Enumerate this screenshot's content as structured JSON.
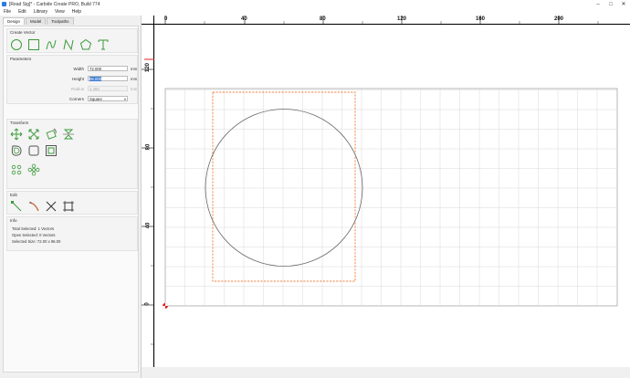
{
  "window": {
    "title": "[Read Sig]* - Carbide Create PRO, Build 774",
    "controls": [
      "–",
      "□",
      "✕"
    ]
  },
  "menubar": [
    "File",
    "Edit",
    "Library",
    "View",
    "Help"
  ],
  "tabs": [
    {
      "label": "Design",
      "active": true
    },
    {
      "label": "Model",
      "active": false
    },
    {
      "label": "Toolpaths",
      "active": false
    }
  ],
  "create_vector": {
    "title": "Create Vector",
    "icons": [
      "circle-tool-icon",
      "rectangle-tool-icon",
      "curve-tool-icon",
      "polyline-tool-icon",
      "polygon-tool-icon",
      "text-tool-icon"
    ]
  },
  "parameters": {
    "title": "Parameters",
    "width_label": "Width",
    "width_value": "72.000",
    "width_unit": "mm",
    "height_label": "Height",
    "height_value": "96.000",
    "height_unit": "mm",
    "radius_label": "Radius",
    "radius_value": "1.493",
    "radius_unit": "mm",
    "corners_label": "Corners",
    "corners_value": "Square"
  },
  "transform": {
    "title": "Transform",
    "row1": [
      "move-icon",
      "scale-icon",
      "rotate-icon",
      "mirror-icon"
    ],
    "row2": [
      "offset-icon",
      "boolean-icon",
      "inset-icon"
    ],
    "row3": [
      "array-icon",
      "circular-array-icon"
    ]
  },
  "edit": {
    "title": "Edit",
    "icons": [
      "node-edit-icon",
      "knife-icon",
      "trim-icon",
      "bounding-box-icon"
    ]
  },
  "info": {
    "title": "Info",
    "total_selected": "Total Selected:  1 Vectors",
    "open_selected": "Open Selected:  0 Vectors",
    "selected_size": "Selected Size:    72.00 x 96.00"
  },
  "ruler_top": [
    "0",
    "40",
    "80",
    "120",
    "160",
    "200"
  ],
  "ruler_left": [
    "120",
    "80",
    "40",
    "0"
  ],
  "colors": {
    "vector": "#666666",
    "selection": "#f07f3c",
    "grid": "#d0d0d0",
    "origin": "#e02020",
    "tool_green": "#3a9a3a",
    "highlight": "#3a7bd5"
  }
}
